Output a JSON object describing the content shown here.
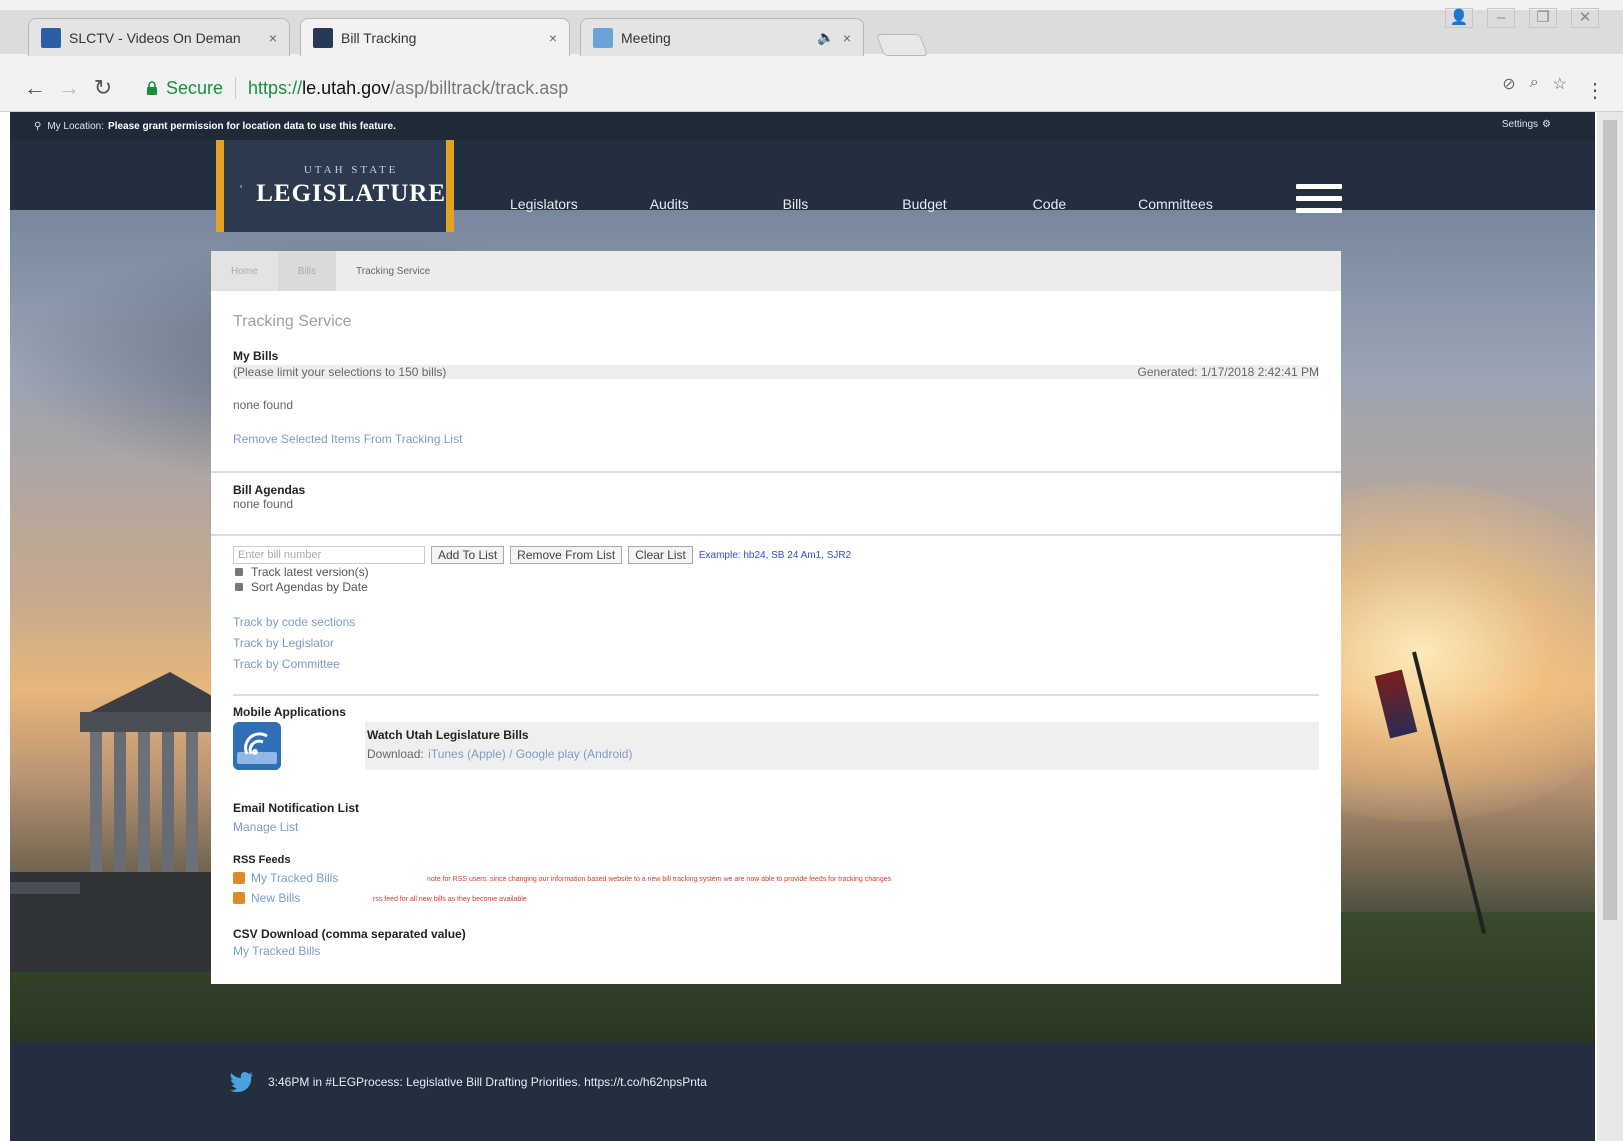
{
  "browser": {
    "tabs": [
      {
        "title": "SLCTV - Videos On Deman",
        "active": false,
        "favicon_color": "#2c5ea8"
      },
      {
        "title": "Bill Tracking",
        "active": true,
        "favicon_color": "#263a55"
      },
      {
        "title": "Meeting",
        "active": false,
        "favicon_color": "#6aa3d8"
      }
    ],
    "tab_close": "×",
    "secure_label": "Secure",
    "url": {
      "scheme": "https://",
      "host": "le.utah.gov",
      "path": "/asp/billtrack/track.asp"
    }
  },
  "infobar": {
    "label": "My Location:",
    "message": "Please grant permission for location data to use this feature.",
    "settings": "Settings"
  },
  "site": {
    "logo_small": "UTAH STATE",
    "logo_big": "LEGISLATURE",
    "nav": [
      "Legislators",
      "Audits",
      "Bills",
      "Budget",
      "Code",
      "Committees"
    ]
  },
  "breadcrumb": [
    "Home",
    "Bills",
    "Tracking Service"
  ],
  "page": {
    "title": "Tracking Service",
    "my_bills": {
      "heading": "My Bills",
      "limit_note": "(Please limit your selections to 150 bills)",
      "generated": "Generated: 1/17/2018 2:42:41 PM",
      "empty": "none found",
      "remove_link": "Remove Selected Items From Tracking List"
    },
    "agendas": {
      "heading": "Bill Agendas",
      "empty": "none found"
    },
    "add": {
      "placeholder": "Enter bill number",
      "add_button": "Add To List",
      "remove_button": "Remove From List",
      "clear_button": "Clear List",
      "example": "Example: hb24, SB 24 Am1, SJR2",
      "options": [
        "Track latest version(s)",
        "Sort Agendas by Date"
      ]
    },
    "track_links": [
      "Track by code sections",
      "Track by Legislator",
      "Track by Committee"
    ],
    "mobile": {
      "heading": "Mobile Applications",
      "app_name": "Watch Utah Legislature Bills",
      "download_label": "Download:",
      "download_links": "iTunes (Apple) / Google play (Android)"
    },
    "email": {
      "heading": "Email Notification List",
      "link": "Manage List"
    },
    "rss": {
      "heading": "RSS Feeds",
      "items": [
        {
          "label": "My Tracked Bills",
          "note": "note for RSS users: since changing our information based website to a new bill tracking system we are now able to provide feeds for tracking changes"
        },
        {
          "label": "New Bills",
          "note": "rss feed for all new bills as they become available"
        }
      ]
    },
    "csv": {
      "heading": "CSV Download (comma separated value)",
      "link": "My Tracked Bills"
    }
  },
  "footer": {
    "tweet": "3:46PM in #LEGProcess: Legislative Bill Drafting Priorities. https://t.co/h62npsPnta"
  },
  "colors": {
    "nav_bg": "#232f3e",
    "logo_accent": "#e0a324",
    "link": "#7d9bc4",
    "secure_green": "#1a8f3c",
    "rss_orange": "#e08a2a",
    "note_red": "#d23a3a"
  }
}
